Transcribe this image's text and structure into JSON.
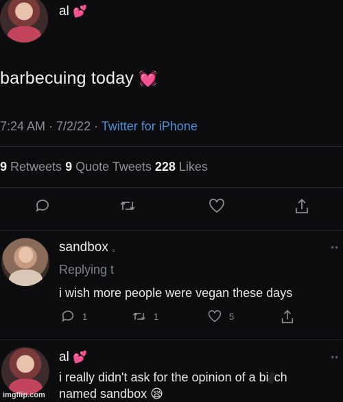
{
  "main_tweet": {
    "author": "al",
    "author_emoji": "💕",
    "text": "barbecuing today",
    "text_emoji": "💓",
    "time": "7:24 AM · 7/2/22 · ",
    "source": "Twitter for iPhone",
    "retweets_count": "9",
    "retweets_label": " Retweets ",
    "quote_count": "9",
    "quote_label": " Quote Tweets ",
    "likes_count": "228",
    "likes_label": " Likes"
  },
  "reply1": {
    "author": "sandbox",
    "author_suffix": "。",
    "replying": "Replying t",
    "text": "i wish more people were vegan these days",
    "reply_count": "1",
    "retweet_count": "1",
    "like_count": "5"
  },
  "reply2": {
    "author": "al",
    "author_emoji": "💕",
    "line1": "i really didn't ask for the opinion of a bi",
    "line1_end": "ch",
    "line2": "named sandbox",
    "line2_emoji": "😪"
  },
  "more_icon": "more-dots-icon",
  "watermark": "imgflip.com",
  "colors": {
    "background": "#0d0d0f",
    "text": "#e8e8ea",
    "muted": "#8b8f95",
    "link": "#4b8fd6",
    "heart": "#e0479e"
  }
}
